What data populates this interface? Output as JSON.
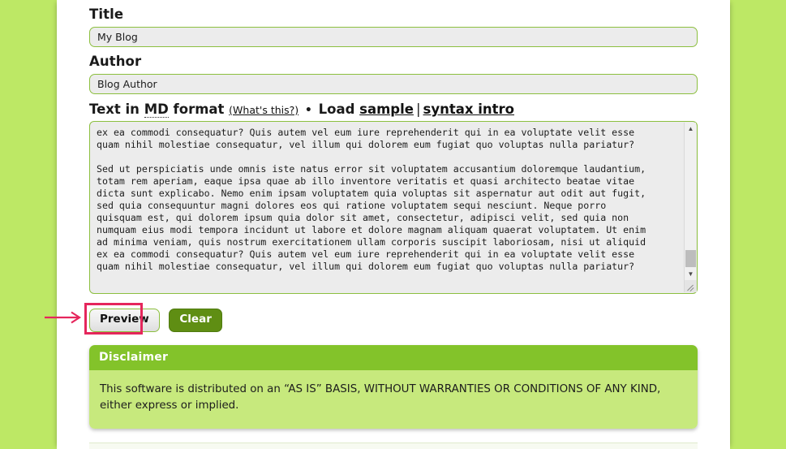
{
  "theme": {
    "page_background": "#bde865",
    "sheet_background": "#ffffff",
    "field_border": "#8cbf3f",
    "field_fill": "#ececec",
    "clear_button_fill": "#5f8e13",
    "disclaimer_header_fill": "#83c32a",
    "disclaimer_body_fill": "#c7e97d",
    "annotation_accent": "#e5265c"
  },
  "form": {
    "title_label": "Title",
    "title_value": "My Blog",
    "title_placeholder": "Title",
    "author_label": "Author",
    "author_value": "Blog Author",
    "author_placeholder": "Author",
    "md_row": {
      "prefix": "Text in ",
      "abbr": "MD",
      "suffix": " format ",
      "help_link": "(What's this?)",
      "bullet": "•",
      "load_text": "Load ",
      "sample_link": "sample",
      "separator": "|",
      "syntax_link": "syntax intro"
    },
    "textarea_value": "ex ea commodi consequatur? Quis autem vel eum iure reprehenderit qui in ea voluptate velit esse\nquam nihil molestiae consequatur, vel illum qui dolorem eum fugiat quo voluptas nulla pariatur?\n\nSed ut perspiciatis unde omnis iste natus error sit voluptatem accusantium doloremque laudantium,\ntotam rem aperiam, eaque ipsa quae ab illo inventore veritatis et quasi architecto beatae vitae\ndicta sunt explicabo. Nemo enim ipsam voluptatem quia voluptas sit aspernatur aut odit aut fugit,\nsed quia consequuntur magni dolores eos qui ratione voluptatem sequi nesciunt. Neque porro\nquisquam est, qui dolorem ipsum quia dolor sit amet, consectetur, adipisci velit, sed quia non\nnumquam eius modi tempora incidunt ut labore et dolore magnam aliquam quaerat voluptatem. Ut enim\nad minima veniam, quis nostrum exercitationem ullam corporis suscipit laboriosam, nisi ut aliquid\nex ea commodi consequatur? Quis autem vel eum iure reprehenderit qui in ea voluptate velit esse\nquam nihil molestiae consequatur, vel illum qui dolorem eum fugiat quo voluptas nulla pariatur?",
    "textarea_placeholder": "Text in MD format"
  },
  "buttons": {
    "preview_label": "Preview",
    "clear_label": "Clear"
  },
  "disclaimer": {
    "heading": "Disclaimer",
    "body": "This software is distributed on an “AS IS” BASIS, WITHOUT WARRANTIES OR CONDITIONS OF ANY KIND, either express or implied."
  },
  "scrollbar": {
    "up_arrow": "▲",
    "down_arrow": "▼"
  }
}
